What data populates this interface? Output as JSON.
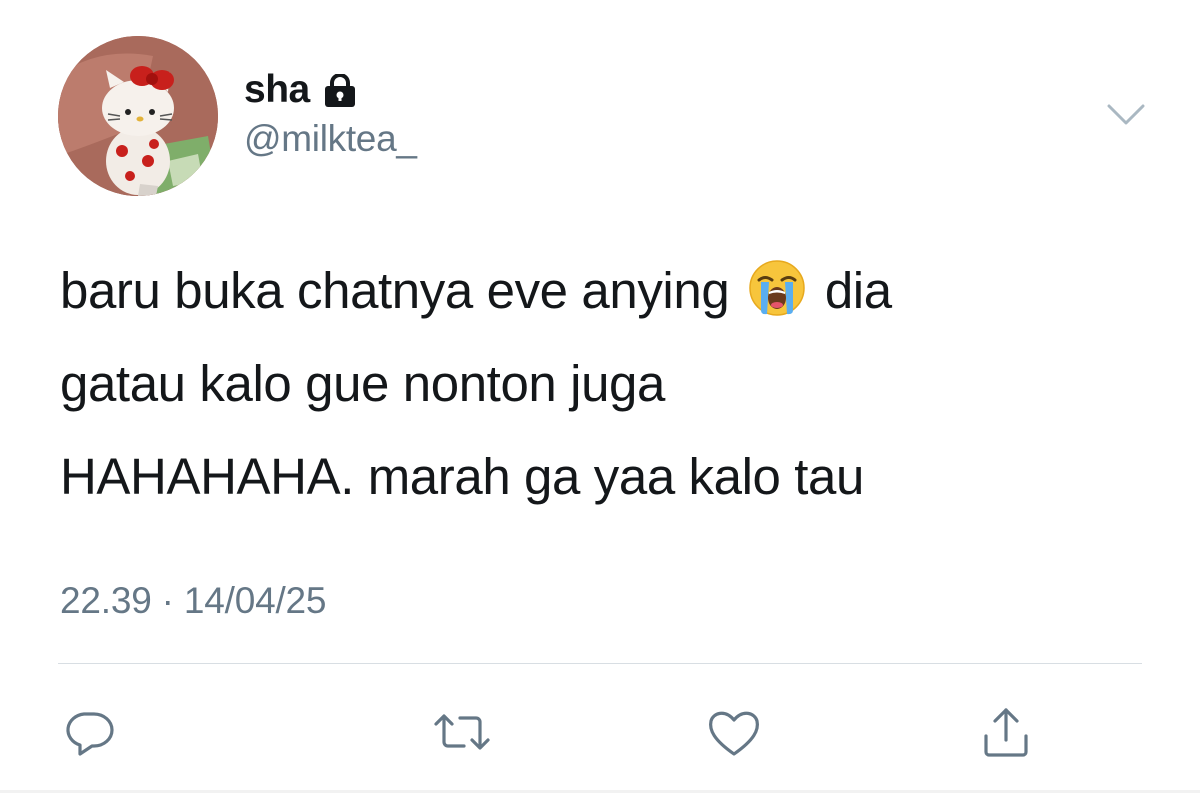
{
  "user": {
    "display_name": "sha",
    "handle": "@milktea_",
    "protected_icon": "lock-icon",
    "avatar": "avatar-hello-kitty-plush"
  },
  "tweet": {
    "lines": [
      {
        "before_emoji": "baru buka chatnya eve anying ",
        "emoji": "loudly-crying-face",
        "after_emoji": " dia"
      },
      {
        "text": "gatau kalo gue nonton juga"
      },
      {
        "text": "HAHAHAHA. marah ga yaa kalo tau"
      }
    ],
    "timestamp": "22.39 · 14/04/25"
  },
  "actions": [
    {
      "name": "reply",
      "icon": "reply-icon"
    },
    {
      "name": "retweet",
      "icon": "retweet-icon"
    },
    {
      "name": "like",
      "icon": "heart-icon"
    },
    {
      "name": "share",
      "icon": "share-icon"
    }
  ],
  "menu": {
    "icon": "chevron-down-icon"
  },
  "colors": {
    "text": "#14171a",
    "secondary": "#657786",
    "divider": "#d8dee3",
    "icon": "#657786"
  }
}
